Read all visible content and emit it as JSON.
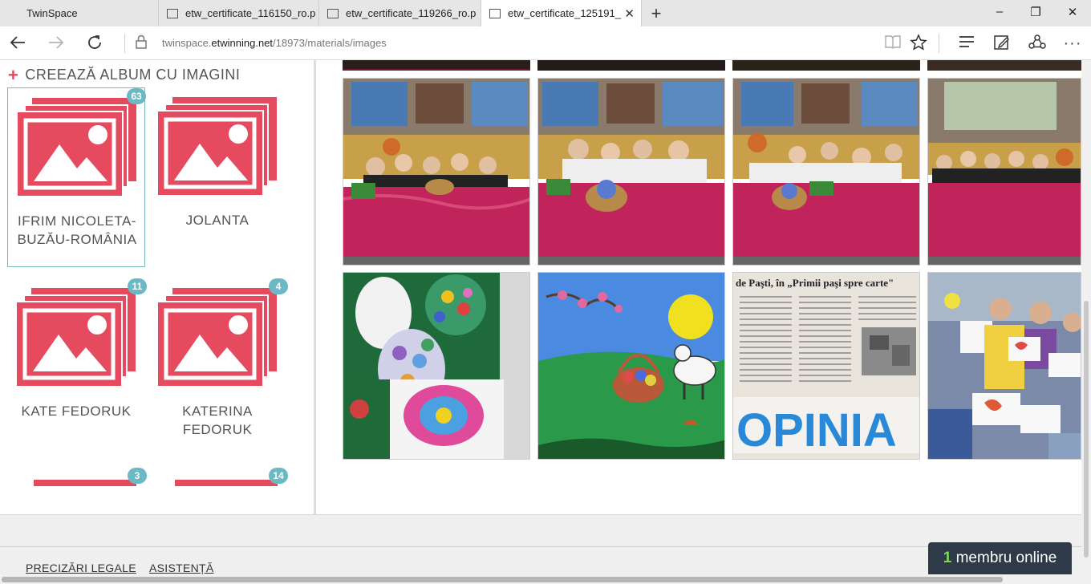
{
  "browser": {
    "tabs": [
      {
        "title": "TwinSpace",
        "active": false
      },
      {
        "title": "etw_certificate_116150_ro.p",
        "active": false
      },
      {
        "title": "etw_certificate_119266_ro.p",
        "active": false
      },
      {
        "title": "etw_certificate_125191_",
        "active": true
      }
    ],
    "url_prefix": "twinspace.",
    "url_host": "etwinning.net",
    "url_path": "/18973/materials/images",
    "window_controls": {
      "minimize": "–",
      "restore": "❐",
      "close": "✕"
    }
  },
  "sidebar": {
    "create_album_label": "CREEAZĂ ALBUM CU IMAGINI",
    "albums": [
      {
        "name": "IFRIM NICOLETA-BUZĂU-ROMÂNIA",
        "count": "63",
        "selected": true
      },
      {
        "name": "JOLANTA",
        "count": "",
        "selected": false
      },
      {
        "name": "KATE FEDORUK",
        "count": "11",
        "selected": false
      },
      {
        "name": "KATERINA FEDORUK",
        "count": "4",
        "selected": false
      },
      {
        "name": "",
        "count": "3",
        "selected": false
      },
      {
        "name": "",
        "count": "14",
        "selected": false
      }
    ]
  },
  "gallery": {
    "photos": [
      {
        "subject": "classroom-easter-photo-1"
      },
      {
        "subject": "classroom-easter-photo-2"
      },
      {
        "subject": "classroom-easter-photo-3"
      },
      {
        "subject": "classroom-easter-photo-4"
      },
      {
        "subject": "quilled-eggs-collage"
      },
      {
        "subject": "easter-lamb-drawing"
      },
      {
        "subject": "newspaper-clipping"
      },
      {
        "subject": "children-drawings-photo"
      }
    ],
    "newspaper_headline": "de Paşti, în „Primii paşi spre carte\"",
    "newspaper_masthead": "OPINIA"
  },
  "footer": {
    "legal_label": "PRECIZĂRI LEGALE",
    "help_label": "ASISTENȚĂ"
  },
  "online_widget": {
    "count": "1",
    "label": " membru online"
  },
  "colors": {
    "accent": "#e54a5e",
    "badge": "#6ab9c5",
    "selected_border": "#7ab8c1",
    "online_bg": "#2e3a47"
  }
}
